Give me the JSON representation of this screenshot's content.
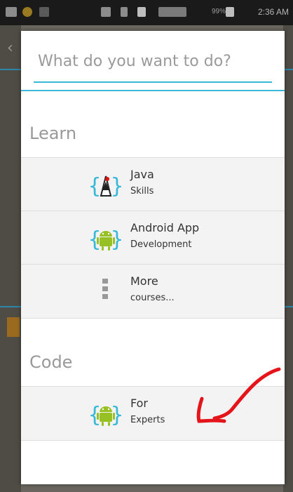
{
  "status_bar": {
    "battery": "99%",
    "time": "2:36 AM"
  },
  "search": {
    "placeholder": "What do you want to do?"
  },
  "sections": {
    "learn": {
      "title": "Learn",
      "items": [
        {
          "title": "Java",
          "subtitle": "Skills",
          "icon": "java-duke-icon"
        },
        {
          "title": "Android App",
          "subtitle": "Development",
          "icon": "android-icon"
        },
        {
          "title": "More",
          "subtitle": "courses...",
          "icon": "more-dots-icon"
        }
      ]
    },
    "code": {
      "title": "Code",
      "items": [
        {
          "title": "For",
          "subtitle": "Experts",
          "icon": "android-icon"
        }
      ]
    }
  },
  "colors": {
    "accent": "#39b8d8",
    "android_green": "#97c024",
    "arrow_red": "#e5141b"
  }
}
